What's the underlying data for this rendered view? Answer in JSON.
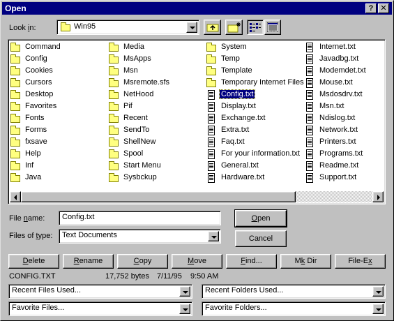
{
  "window": {
    "title": "Open",
    "help_label": "?",
    "close_label": "✕"
  },
  "lookin": {
    "label_pre": "Look ",
    "label_accel": "i",
    "label_post": "n:",
    "value": "Win95"
  },
  "toolbar": {
    "up_icon": "up-folder-icon",
    "newfolder_icon": "new-folder-icon",
    "list_icon": "list-view-icon",
    "details_icon": "details-view-icon"
  },
  "files": {
    "col1": [
      "Command",
      "Config",
      "Cookies",
      "Cursors",
      "Desktop",
      "Favorites",
      "Fonts",
      "Forms",
      "fxsave",
      "Help",
      "Inf",
      "Java"
    ],
    "col2": [
      "Media",
      "MsApps",
      "Msn",
      "Msremote.sfs",
      "NetHood",
      "Pif",
      "Recent",
      "SendTo",
      "ShellNew",
      "Spool",
      "Start Menu",
      "Sysbckup"
    ],
    "col3": [
      {
        "name": "System",
        "type": "folder"
      },
      {
        "name": "Temp",
        "type": "folder"
      },
      {
        "name": "Template",
        "type": "folder"
      },
      {
        "name": "Temporary Internet Files",
        "type": "folder"
      },
      {
        "name": "Config.txt",
        "type": "doc",
        "selected": true
      },
      {
        "name": "Display.txt",
        "type": "doc"
      },
      {
        "name": "Exchange.txt",
        "type": "doc"
      },
      {
        "name": "Extra.txt",
        "type": "doc"
      },
      {
        "name": "Faq.txt",
        "type": "doc"
      },
      {
        "name": "For your information.txt",
        "type": "doc"
      },
      {
        "name": "General.txt",
        "type": "doc"
      },
      {
        "name": "Hardware.txt",
        "type": "doc"
      }
    ],
    "col4": [
      "Internet.txt",
      "Javadbg.txt",
      "Modemdet.txt",
      "Mouse.txt",
      "Msdosdrv.txt",
      "Msn.txt",
      "Ndislog.txt",
      "Network.txt",
      "Printers.txt",
      "Programs.txt",
      "Readme.txt",
      "Support.txt"
    ]
  },
  "filename": {
    "label_pre": "File ",
    "label_accel": "n",
    "label_post": "ame:",
    "value": "Config.txt"
  },
  "filetype": {
    "label_pre": "Files of ",
    "label_accel": "t",
    "label_post": "ype:",
    "value": "Text Documents"
  },
  "buttons": {
    "open_accel": "O",
    "open_rest": "pen",
    "cancel": "Cancel",
    "delete_accel": "D",
    "delete_rest": "elete",
    "rename_accel": "R",
    "rename_rest": "ename",
    "copy_accel": "C",
    "copy_rest": "opy",
    "move_accel": "M",
    "move_rest": "ove",
    "find_accel": "F",
    "find_rest": "ind...",
    "mkdir_pre": "M",
    "mkdir_accel": "k",
    "mkdir_rest": " Dir",
    "filex_pre": "File-E",
    "filex_accel": "x"
  },
  "status": {
    "filename": "CONFIG.TXT",
    "size": "17,752 bytes",
    "date": "7/11/95",
    "time": "9:50 AM"
  },
  "dropdowns": {
    "recent_files": "Recent Files Used...",
    "recent_folders": "Recent Folders Used...",
    "favorite_files": "Favorite Files...",
    "favorite_folders": "Favorite Folders..."
  }
}
